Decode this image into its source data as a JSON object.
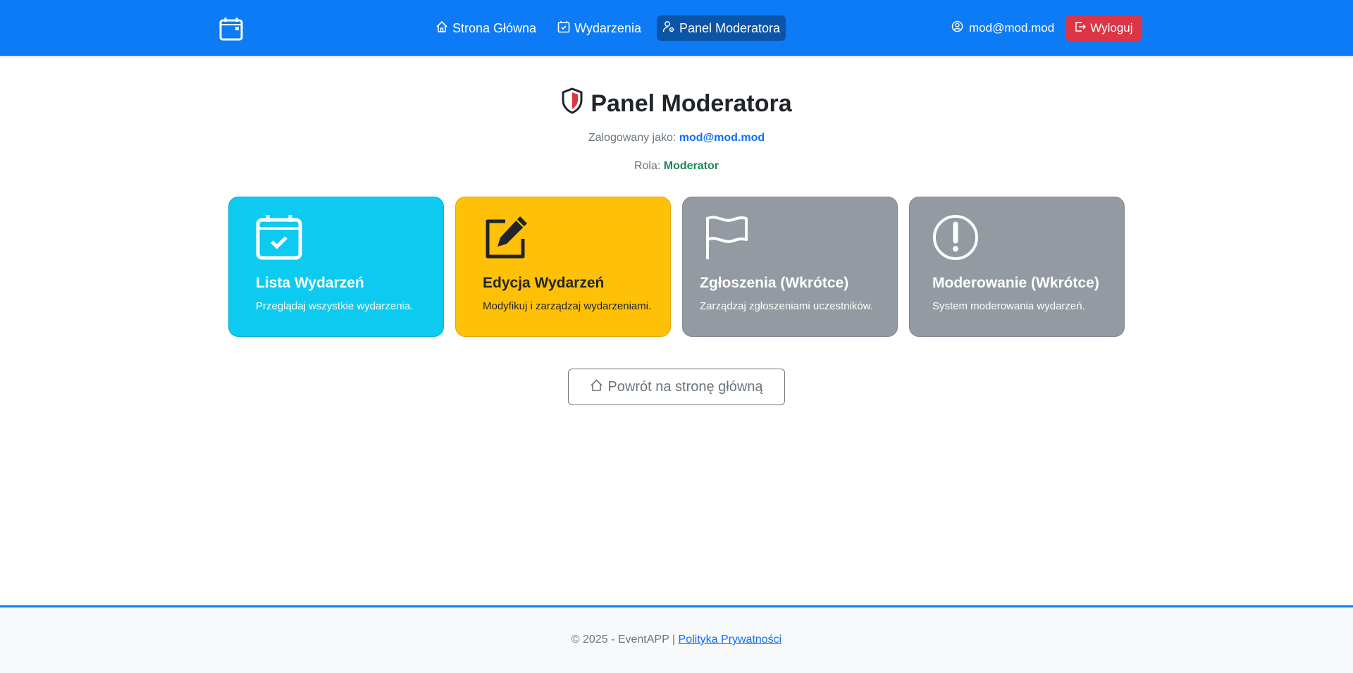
{
  "navbar": {
    "brand_icon": "calendar-icon",
    "links": [
      {
        "label": "Strona Główna",
        "icon": "house-icon"
      },
      {
        "label": "Wydarzenia",
        "icon": "calendar-check-icon"
      },
      {
        "label": "Panel Moderatora",
        "icon": "person-gear-icon",
        "active": true
      }
    ],
    "user_email": "mod@mod.mod",
    "logout_label": "Wyloguj"
  },
  "header": {
    "title": "Panel Moderatora",
    "logged_as_label": "Zalogowany jako:",
    "logged_as_value": "mod@mod.mod",
    "role_label": "Rola:",
    "role_value": "Moderator"
  },
  "cards": [
    {
      "title": "Lista Wydarzeń",
      "desc": "Przeglądaj wszystkie wydarzenia.",
      "icon": "calendar-check-icon",
      "color": "#0dcaf0"
    },
    {
      "title": "Edycja Wydarzeń",
      "desc": "Modyfikuj i zarządzaj wydarzeniami.",
      "icon": "pencil-square-icon",
      "color": "#ffc107"
    },
    {
      "title": "Zgłoszenia (Wkrótce)",
      "desc": "Zarządzaj zgłoszeniami uczestników.",
      "icon": "flag-icon",
      "color": "#939aa1"
    },
    {
      "title": "Moderowanie (Wkrótce)",
      "desc": "System moderowania wydarzeń.",
      "icon": "exclamation-circle-icon",
      "color": "#939aa1"
    }
  ],
  "back_button": "Powrót na stronę główną",
  "footer": {
    "copyright": "© 2025 - EventAPP |",
    "privacy_link": "Polityka Prywatności"
  },
  "colors": {
    "primary": "#0d7bf5",
    "danger": "#dc3545",
    "success": "#198754"
  }
}
